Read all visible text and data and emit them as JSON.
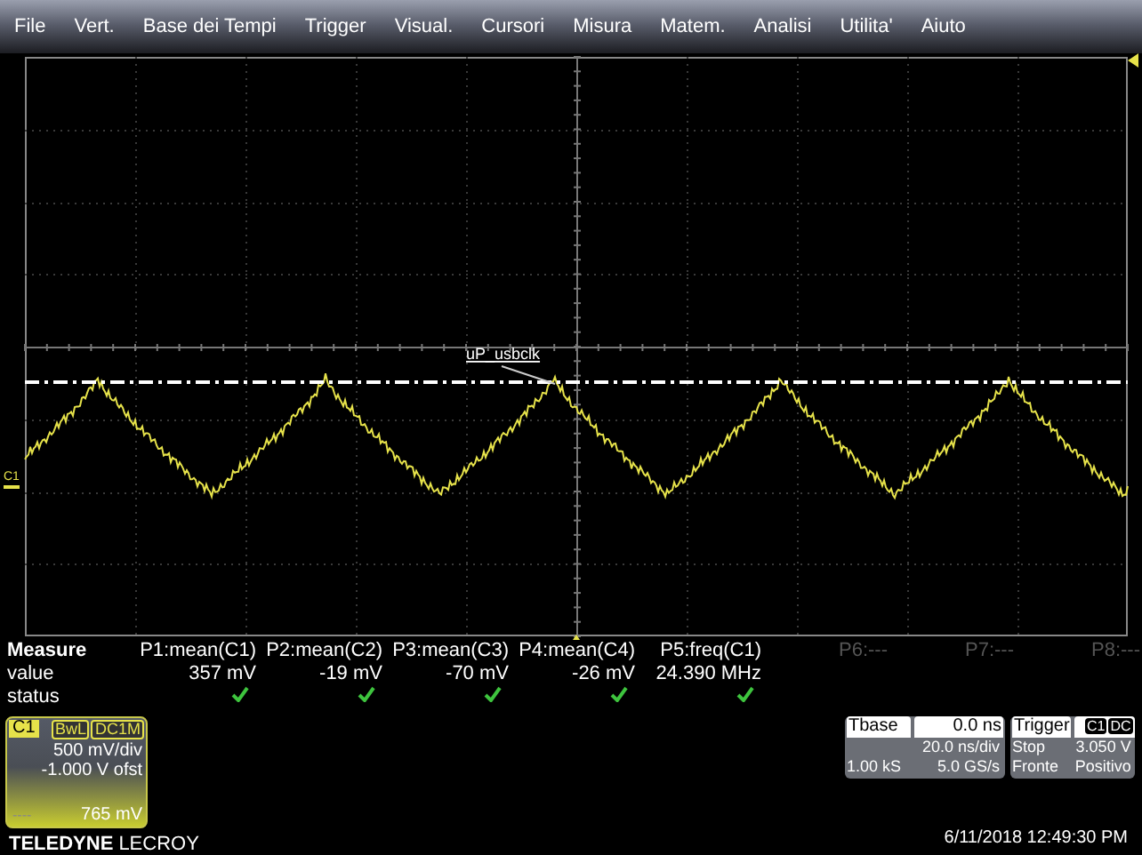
{
  "menu": [
    {
      "label": "File"
    },
    {
      "label": "Vert."
    },
    {
      "label": "Base dei Tempi"
    },
    {
      "label": "Trigger"
    },
    {
      "label": "Visual."
    },
    {
      "label": "Cursori"
    },
    {
      "label": "Misura"
    },
    {
      "label": "Matem."
    },
    {
      "label": "Analisi"
    },
    {
      "label": "Utilita'"
    },
    {
      "label": "Aiuto"
    }
  ],
  "display": {
    "trace_label": "uP_usbclk",
    "channel_marker": "C1"
  },
  "measure": {
    "row_labels": [
      "Measure",
      "value",
      "status"
    ],
    "parameters": [
      {
        "name": "P1:mean(C1)",
        "value": "357 mV",
        "valid": true,
        "disabled": false
      },
      {
        "name": "P2:mean(C2)",
        "value": "-19 mV",
        "valid": true,
        "disabled": false
      },
      {
        "name": "P3:mean(C3)",
        "value": "-70 mV",
        "valid": true,
        "disabled": false
      },
      {
        "name": "P4:mean(C4)",
        "value": "-26 mV",
        "valid": true,
        "disabled": false
      },
      {
        "name": "P5:freq(C1)",
        "value": "24.390 MHz",
        "valid": true,
        "disabled": false
      },
      {
        "name": "P6:---",
        "valid": false,
        "disabled": true
      },
      {
        "name": "P7:---",
        "valid": false,
        "disabled": true
      },
      {
        "name": "P8:---",
        "valid": false,
        "disabled": true
      }
    ]
  },
  "channel": {
    "name": "C1",
    "tags": [
      "BwL",
      "DC1M"
    ],
    "scale": "500 mV/div",
    "offset": "-1.000 V ofst",
    "indicator": "----",
    "reading": "765 mV"
  },
  "timebase": {
    "title": "Tbase",
    "delay": "0.0 ns",
    "scale": "20.0 ns/div",
    "samples": "1.00 kS",
    "rate": "5.0 GS/s"
  },
  "trigger": {
    "title": "Trigger",
    "tags": [
      "C1",
      "DC"
    ],
    "mode": "Stop",
    "level": "3.050 V",
    "type": "Fronte",
    "slope": "Positivo"
  },
  "logo": {
    "brand": "TELEDYNE",
    "product": "LECROY"
  },
  "timestamp": "6/11/2018 12:49:30 PM"
}
